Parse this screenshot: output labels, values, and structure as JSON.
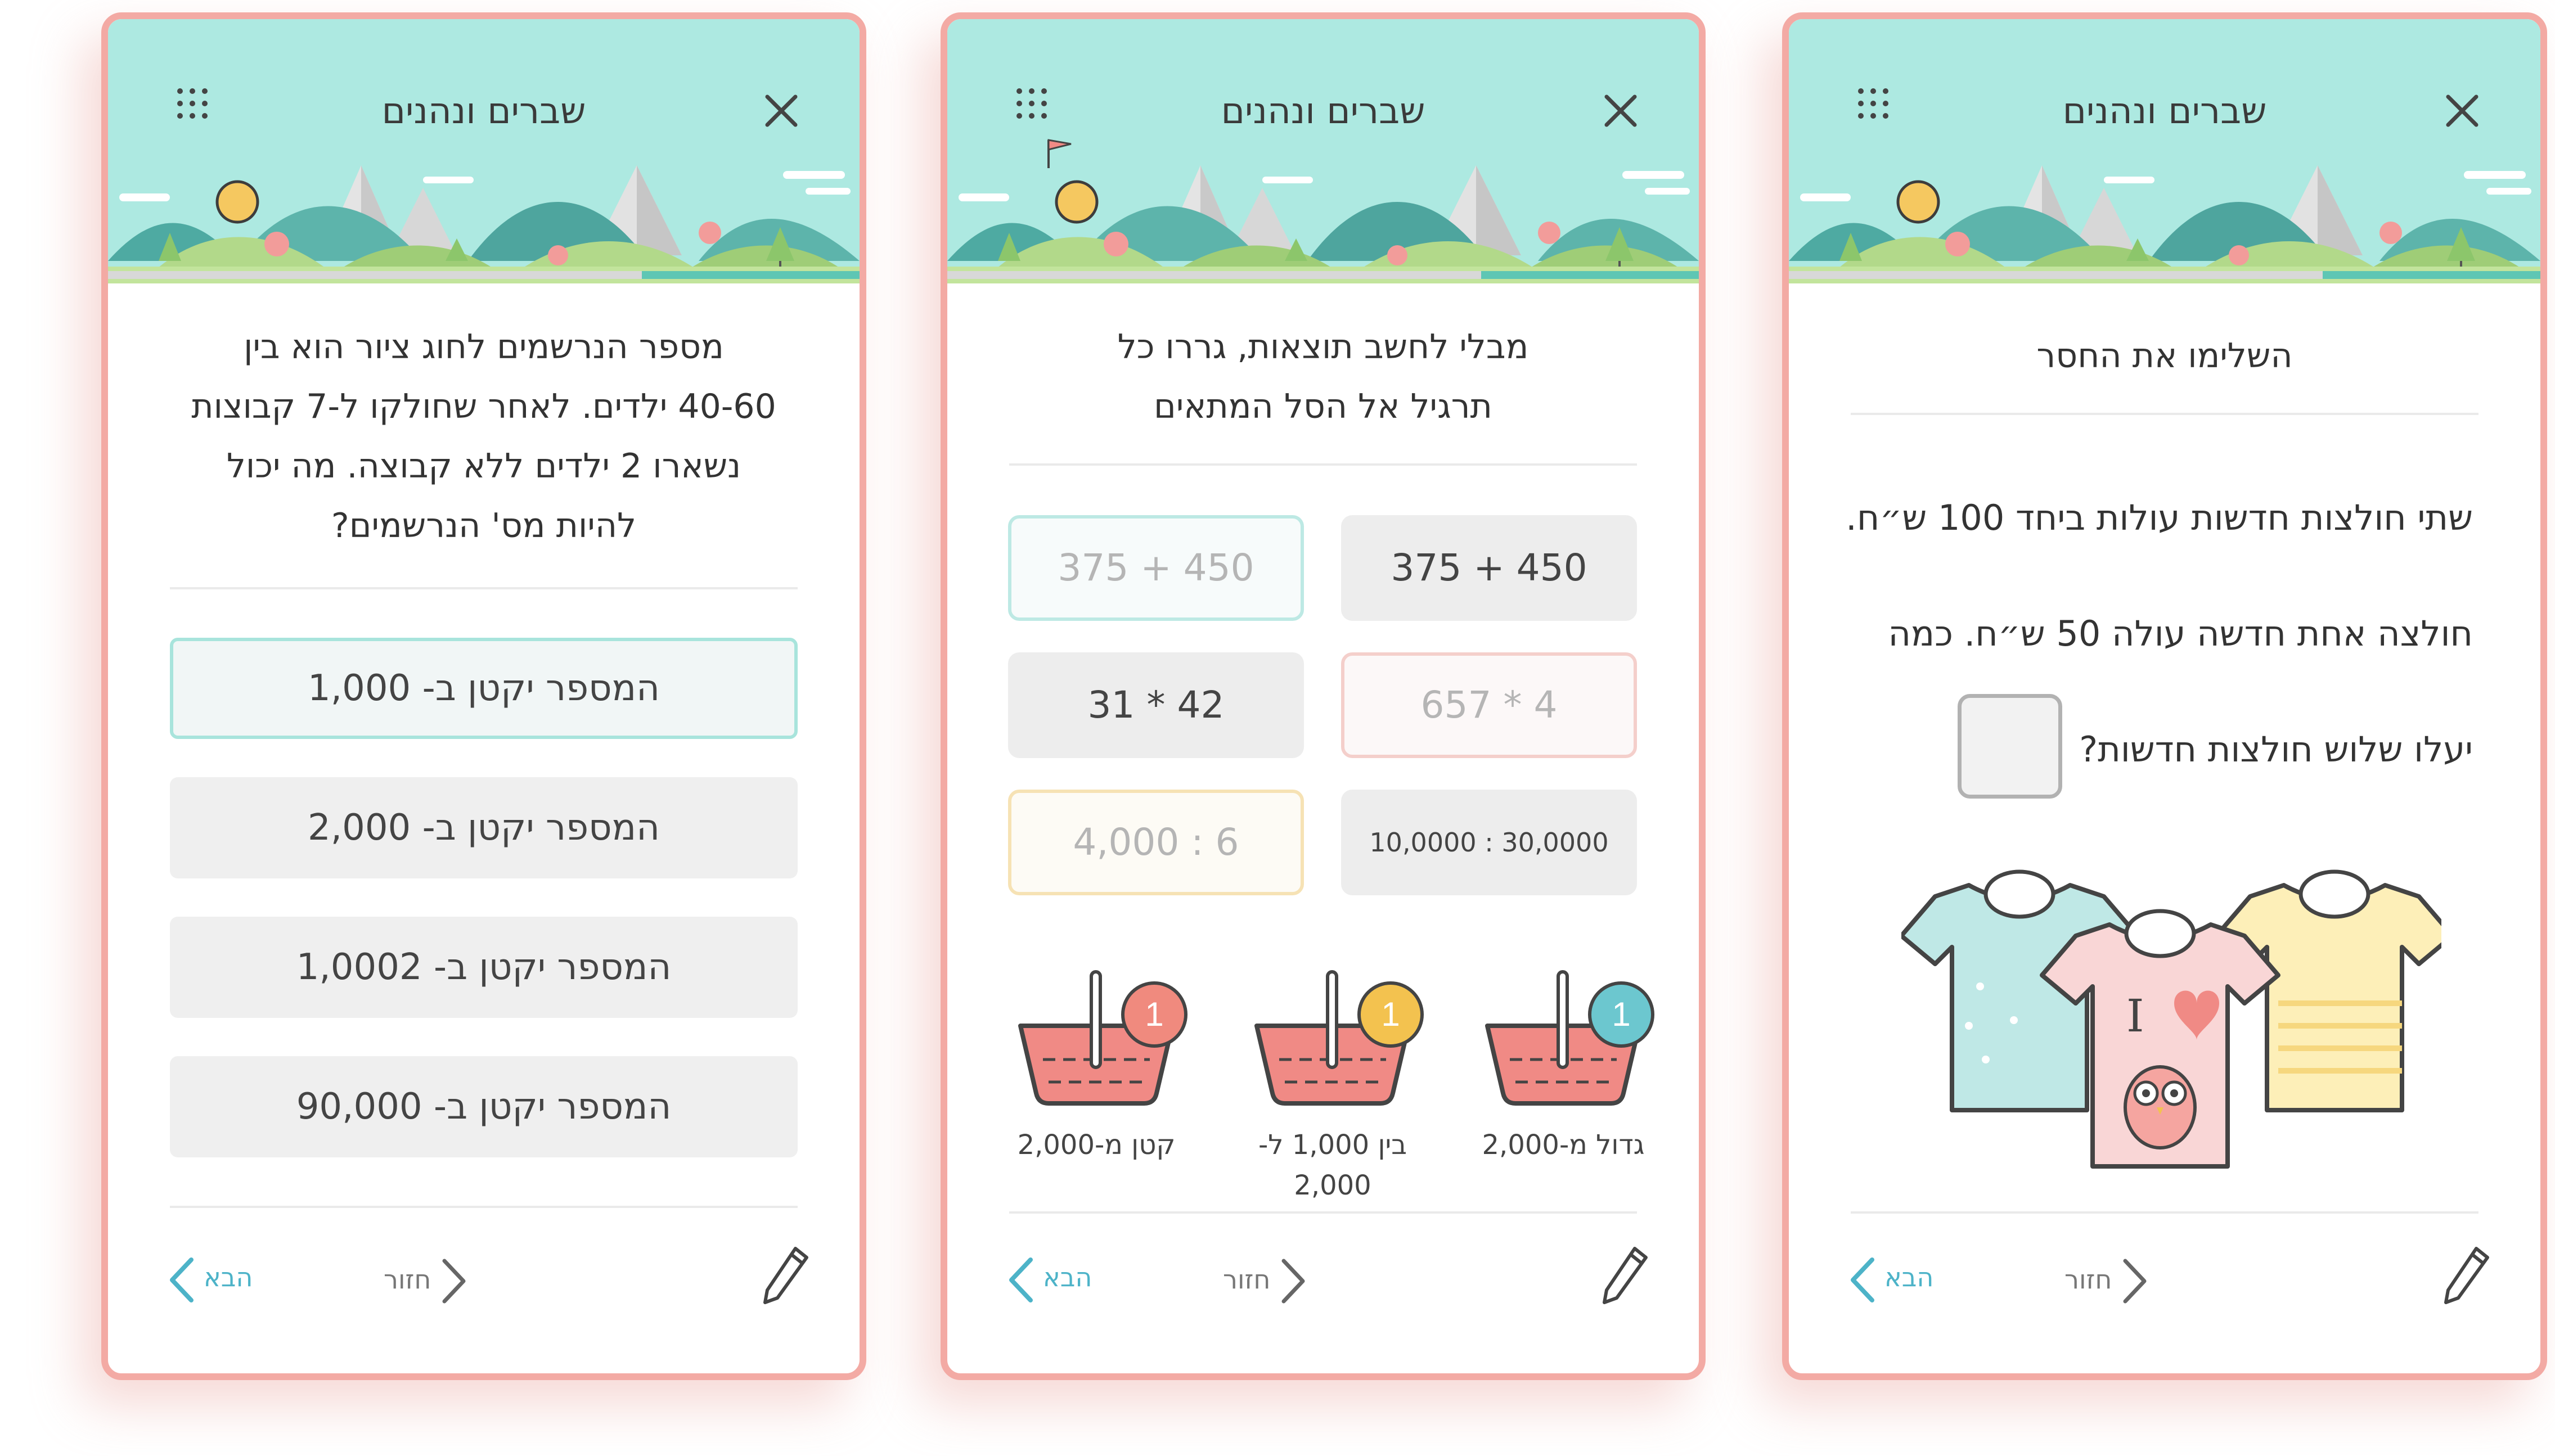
{
  "app": {
    "title": "שברים ונהנים"
  },
  "colors": {
    "accent": "#4db3c8",
    "border": "#f3aaa4",
    "header_bg": "#ade9e1",
    "progress": "#5ec6b4"
  },
  "icons": {
    "menu": "dots-grid-icon",
    "close": "close-icon",
    "edit": "pencil-icon",
    "next": "chevron-left-icon",
    "back": "chevron-right-icon"
  },
  "screens": [
    {
      "title": "שברים ונהנים",
      "progress": 0.29,
      "question_lines": [
        "מספר הנרשמים לחוג ציור הוא בין",
        "40-60 ילדים. לאחר שחולקו ל-7 קבוצות",
        "נשארו 2 ילדים ללא קבוצה. מה יכול",
        "להיות מס' הנרשמים?"
      ],
      "options": [
        "המספר יקטן ב- 1,000",
        "המספר יקטן ב- 2,000",
        "המספר יקטן ב- 1,0002",
        "המספר יקטן ב- 90,000"
      ],
      "selected_option": 0,
      "next_label": "הבא",
      "back_label": "חזור"
    },
    {
      "title": "שברים ונהנים",
      "progress": 0.29,
      "question_lines": [
        "מבלי לחשב תוצאות, גררו כל",
        "תרגיל אל הסל המתאים"
      ],
      "tiles": [
        "375 + 450",
        "375 + 450",
        "657 * 4",
        "31 * 42",
        "10,0000 : 30,0000",
        "4,000 : 6"
      ],
      "baskets": [
        {
          "label": "גדול מ-2,000",
          "count": "1",
          "color": "#6cc7cf"
        },
        {
          "label": "בין 1,000 ל- 2,000",
          "label_lines": [
            "בין 1,000 ל-",
            "2,000"
          ],
          "count": "1",
          "color": "#f3c24f"
        },
        {
          "label": "קטן מ-2,000",
          "count": "1",
          "color": "#f08a7e"
        }
      ],
      "next_label": "הבא",
      "back_label": "חזור"
    },
    {
      "title": "שברים ונהנים",
      "progress": 0.29,
      "heading": "השלימו את החסר",
      "lines": [
        "שתי חולצות חדשות עולות ביחד 100 ש״ח.",
        "חולצה אחת חדשה עולה 50 ש״ח. כמה",
        "יעלו שלוש חולצות חדשות?"
      ],
      "answer_value": "",
      "next_label": "הבא",
      "back_label": "חזור"
    }
  ]
}
